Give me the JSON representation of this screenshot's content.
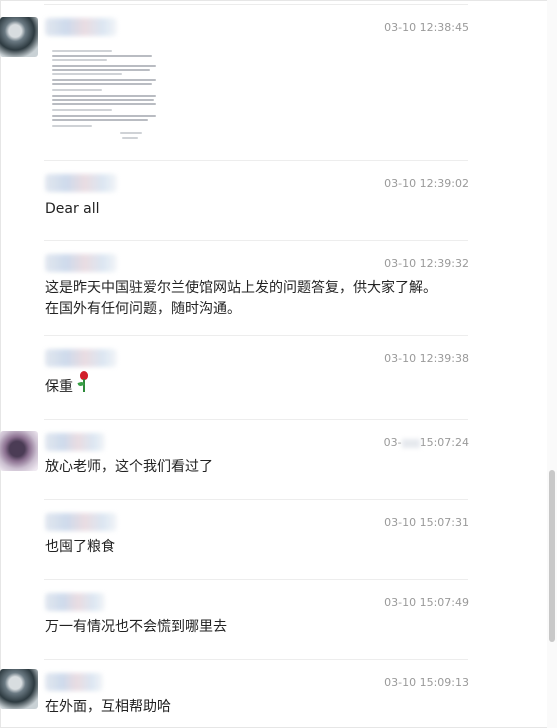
{
  "messages": [
    {
      "time": "03-10 12:38:45",
      "attachment": "document-image"
    },
    {
      "time": "03-10 12:39:02",
      "lines": [
        "Dear all"
      ]
    },
    {
      "time": "03-10 12:39:32",
      "lines": [
        "这是昨天中国驻爱尔兰使馆网站上发的问题答复，供大家了解。",
        "在国外有任何问题，随时沟通。"
      ]
    },
    {
      "time": "03-10 12:39:38",
      "lines": [
        "保重"
      ],
      "emoji": "rose-icon"
    },
    {
      "time_prefix": "03-",
      "time_suffix": "15:07:24",
      "lines": [
        "放心老师，这个我们看过了"
      ]
    },
    {
      "time": "03-10 15:07:31",
      "lines": [
        "也囤了粮食"
      ]
    },
    {
      "time": "03-10 15:07:49",
      "lines": [
        "万一有情况也不会慌到哪里去"
      ]
    },
    {
      "time": "03-10 15:09:13",
      "lines": [
        "在外面，互相帮助哈"
      ]
    }
  ],
  "colors": {
    "text": "#222222",
    "timestamp": "#9a9a9a",
    "separator": "#ededed"
  }
}
